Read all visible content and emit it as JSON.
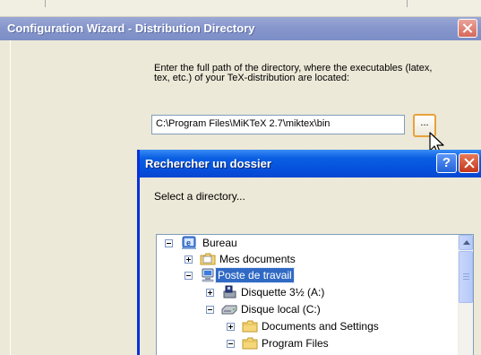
{
  "wizard": {
    "title": "Configuration Wizard - Distribution Directory",
    "instruction": "Enter the full path of the directory, where the executables (latex, tex, etc.) of your TeX-distribution are located:",
    "path_value": "C:\\Program Files\\MiKTeX 2.7\\miktex\\bin",
    "browse_label": "..."
  },
  "dialog": {
    "title": "Rechercher un dossier",
    "help_label": "?",
    "prompt": "Select a directory...",
    "tree": {
      "bureau": "Bureau",
      "mes_documents": "Mes documents",
      "poste_de_travail": "Poste de travail",
      "disquette": "Disquette 3½ (A:)",
      "disque_local": "Disque local (C:)",
      "documents_settings": "Documents and Settings",
      "program_files": "Program Files"
    }
  },
  "colors": {
    "selection": "#316ac5",
    "dialog_title": "#0551dd",
    "inactive_title": "#8797cc"
  },
  "icons": [
    "close-icon",
    "help-icon",
    "desktop-icon",
    "folder-icon",
    "computer-icon",
    "floppy-icon",
    "drive-icon",
    "cursor-icon"
  ]
}
